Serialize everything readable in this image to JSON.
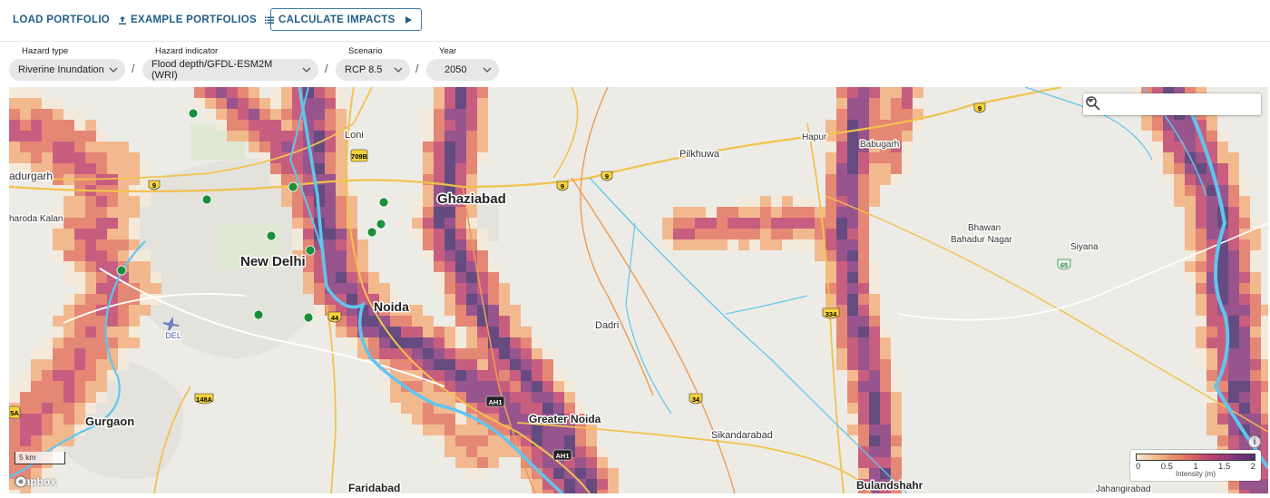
{
  "toolbar": {
    "load_portfolio": "LOAD PORTFOLIO",
    "example_portfolios": "EXAMPLE PORTFOLIOS",
    "calculate_impacts": "CALCULATE IMPACTS",
    "icons": [
      "upload-icon",
      "list-icon",
      "play-icon"
    ]
  },
  "selectors": {
    "hazard_type": {
      "label": "Hazard type",
      "value": "Riverine Inundation"
    },
    "hazard_indicator": {
      "label": "Hazard indicator",
      "value": "Flood depth/GFDL-ESM2M (WRI)"
    },
    "scenario": {
      "label": "Scenario",
      "value": "RCP 8.5"
    },
    "year": {
      "label": "Year",
      "value": "2050"
    },
    "separator": "/"
  },
  "map": {
    "search_placeholder": "",
    "places": {
      "loni": "Loni",
      "ghaziabad": "Ghaziabad",
      "bahadurgarh": "adurgarh",
      "jharoda_kalan": "haroda Kalan",
      "new_delhi": "New Delhi",
      "noida": "Noida",
      "dadri": "Dadri",
      "greater_noida": "Greater Noida",
      "gurgaon": "Gurgaon",
      "faridabad": "Faridabad",
      "sikandarabad": "Sikandarabad",
      "bulandshahr": "Bulandshahr",
      "pilkhuwa": "Pilkhuwa",
      "hapur": "Hapur",
      "babugarh": "Babugarh",
      "bhawan_line1": "Bhawan",
      "bhawan_line2": "Bahadur Nagar",
      "siyana": "Siyana",
      "jahangirabad": "Jahangirabad",
      "airport": "DEL"
    },
    "road_shields": {
      "r709b": "709B",
      "r9a": "9",
      "r9b": "9",
      "r9c": "9",
      "r9d": "9",
      "r44": "44",
      "r148a": "148A",
      "r34": "34",
      "r334": "334",
      "r65": "65",
      "rah1a": "AH1",
      "rah1b": "AH1",
      "r5a": "5A"
    },
    "scale_label": "5 km",
    "attribution": "mapbox",
    "info_label": "i",
    "legend": {
      "ticks": [
        "0",
        "0.5",
        "1",
        "1.5",
        "2"
      ],
      "title": "Intensity (m)",
      "colors": [
        "#f6ead9",
        "#f3b07f",
        "#e47560",
        "#c2456c",
        "#8a3a7c",
        "#4e2f6d"
      ]
    },
    "asset_marker_color": "#1a8f3a",
    "asset_count": 11
  }
}
